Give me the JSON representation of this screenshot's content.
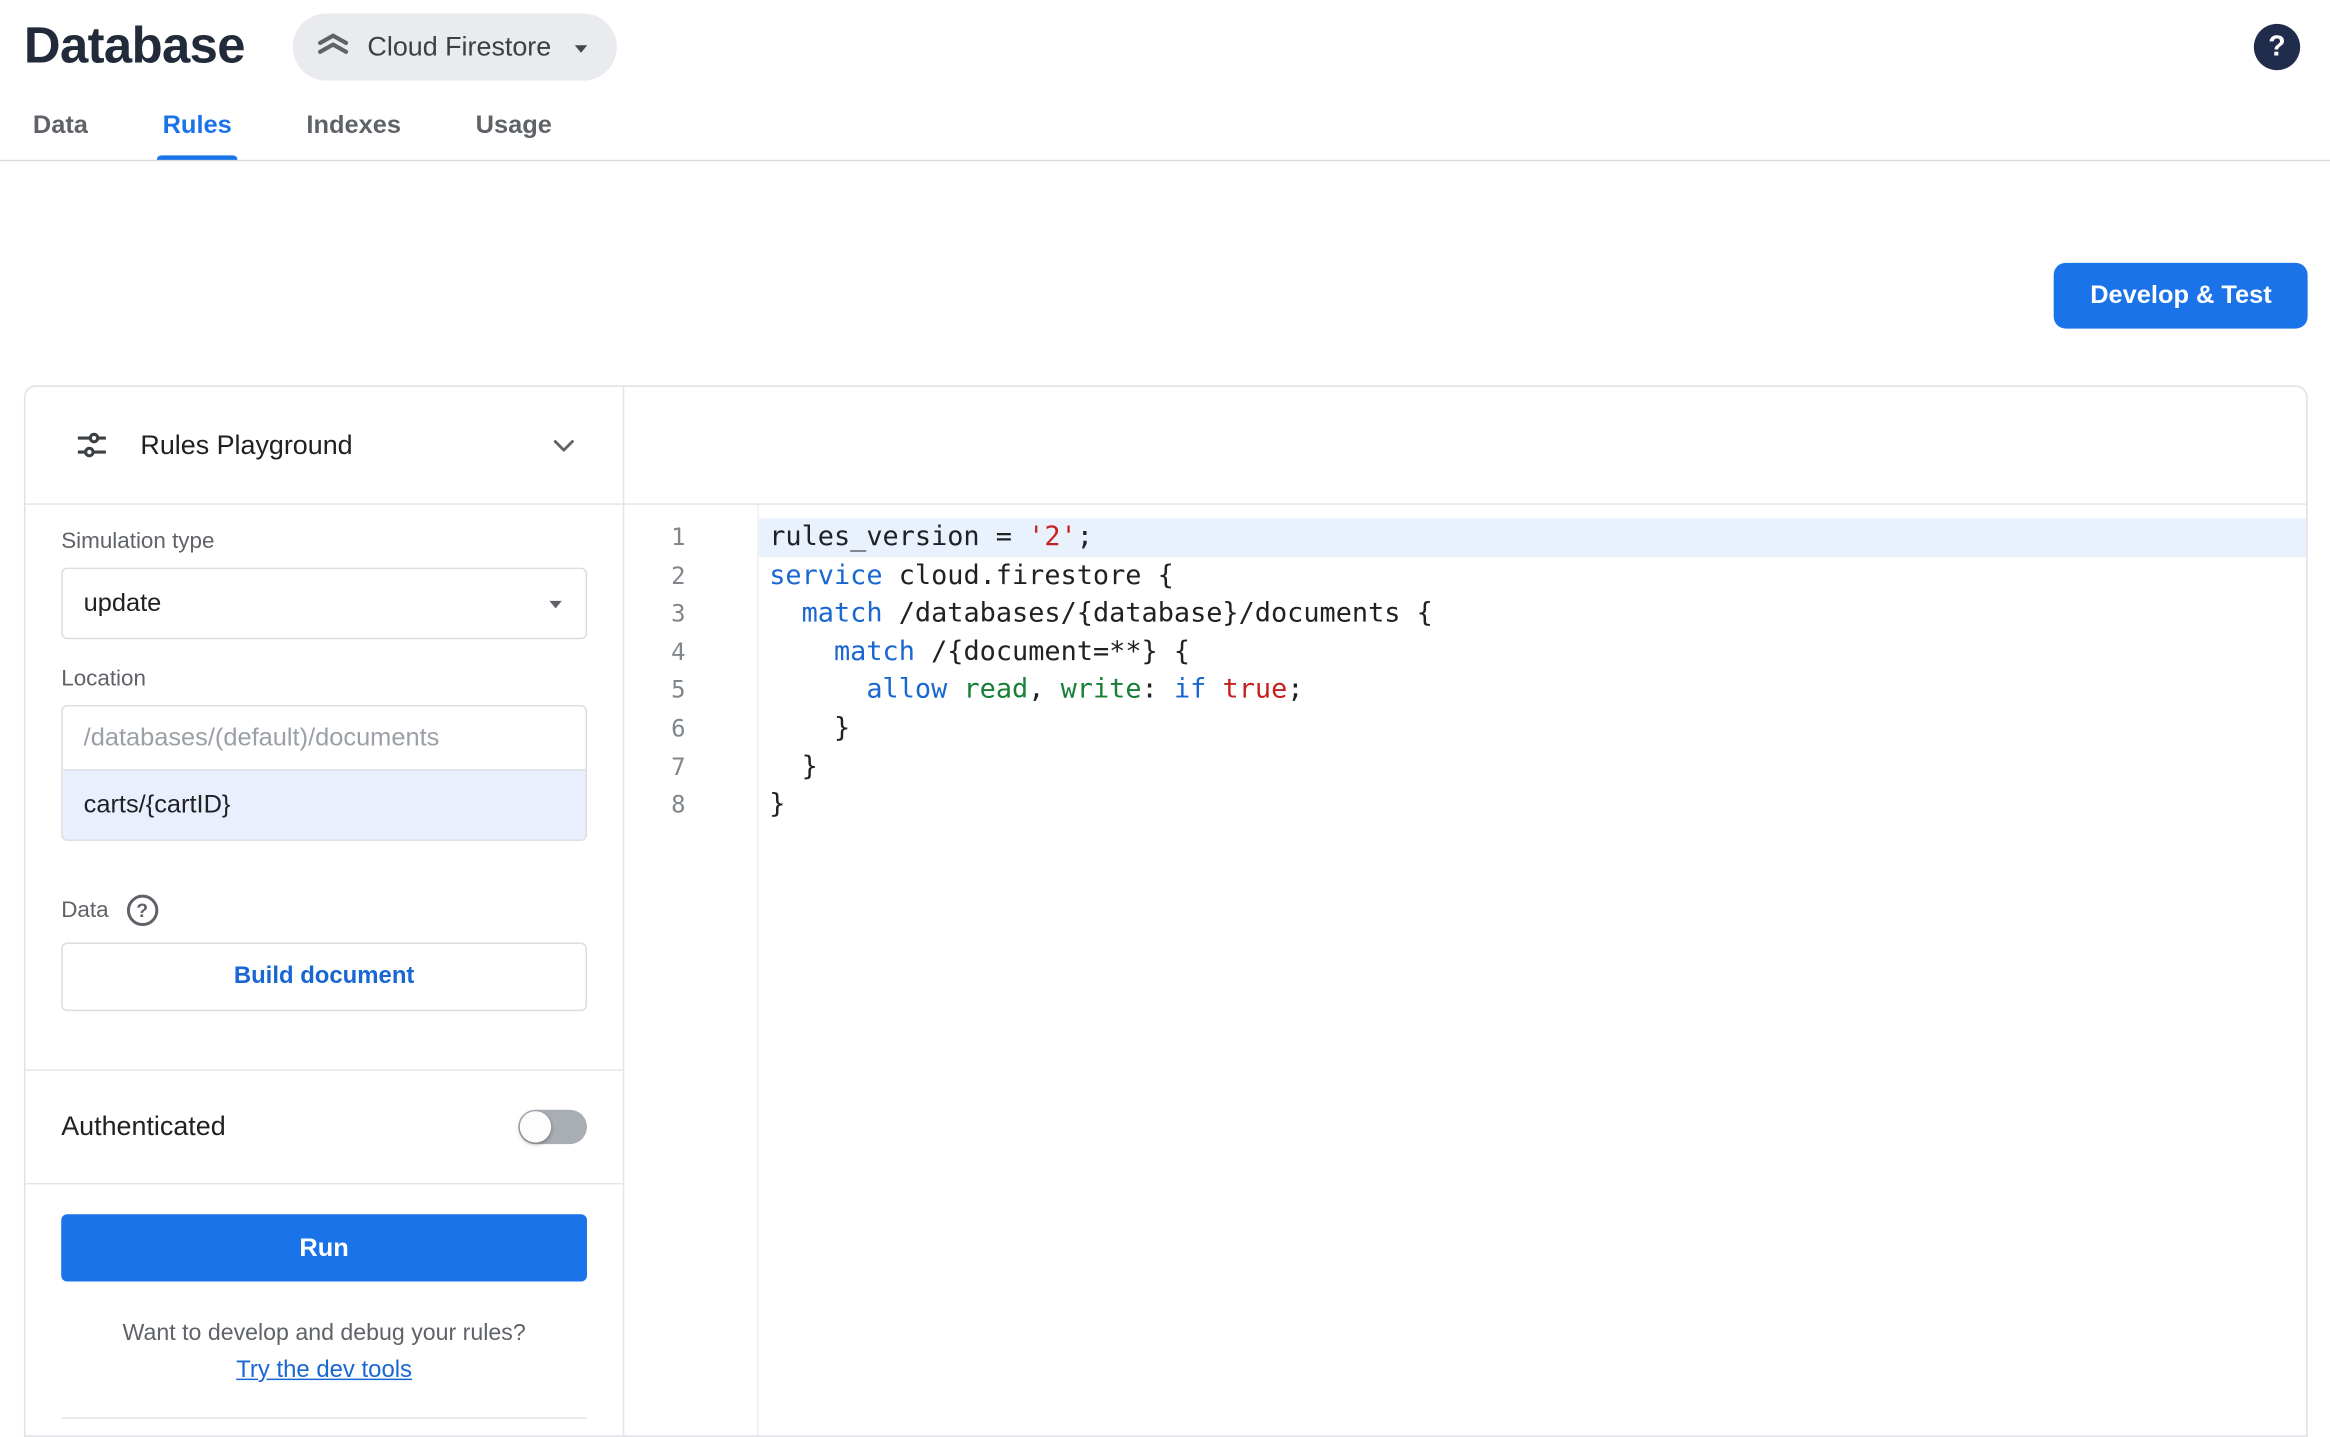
{
  "header": {
    "title": "Database",
    "product_chip": "Cloud Firestore",
    "help_glyph": "?"
  },
  "tabs": [
    {
      "label": "Data"
    },
    {
      "label": "Rules"
    },
    {
      "label": "Indexes"
    },
    {
      "label": "Usage"
    }
  ],
  "active_tab": "Rules",
  "toolbar": {
    "develop_test_label": "Develop & Test"
  },
  "playground": {
    "title": "Rules Playground",
    "simulation_type_label": "Simulation type",
    "simulation_type_value": "update",
    "location_label": "Location",
    "location_placeholder": "/databases/(default)/documents",
    "location_value": "carts/{cartID}",
    "data_label": "Data",
    "data_help_glyph": "?",
    "build_document_label": "Build document",
    "authenticated_label": "Authenticated",
    "authenticated_enabled": false,
    "run_label": "Run",
    "hint_text": "Want to develop and debug your rules?",
    "devtools_link_label": "Try the dev tools"
  },
  "editor": {
    "lines": [
      {
        "num": 1,
        "highlight": true,
        "tokens": [
          {
            "t": "rules_version = "
          },
          {
            "t": "'2'",
            "c": "str"
          },
          {
            "t": ";"
          }
        ]
      },
      {
        "num": 2,
        "highlight": false,
        "tokens": [
          {
            "t": "service",
            "c": "kw"
          },
          {
            "t": " cloud.firestore {"
          }
        ]
      },
      {
        "num": 3,
        "highlight": false,
        "tokens": [
          {
            "t": "  "
          },
          {
            "t": "match",
            "c": "kw"
          },
          {
            "t": " /databases/{database}/documents {"
          }
        ]
      },
      {
        "num": 4,
        "highlight": false,
        "tokens": [
          {
            "t": "    "
          },
          {
            "t": "match",
            "c": "kw"
          },
          {
            "t": " /{document=**} {"
          }
        ]
      },
      {
        "num": 5,
        "highlight": false,
        "tokens": [
          {
            "t": "      "
          },
          {
            "t": "allow",
            "c": "kw"
          },
          {
            "t": " "
          },
          {
            "t": "read",
            "c": "prop"
          },
          {
            "t": ", "
          },
          {
            "t": "write",
            "c": "prop"
          },
          {
            "t": ": "
          },
          {
            "t": "if",
            "c": "kw"
          },
          {
            "t": " "
          },
          {
            "t": "true",
            "c": "bool"
          },
          {
            "t": ";"
          }
        ]
      },
      {
        "num": 6,
        "highlight": false,
        "tokens": [
          {
            "t": "    }"
          }
        ]
      },
      {
        "num": 7,
        "highlight": false,
        "tokens": [
          {
            "t": "  }"
          }
        ]
      },
      {
        "num": 8,
        "highlight": false,
        "tokens": [
          {
            "t": "}"
          }
        ]
      }
    ]
  },
  "colors": {
    "accent_blue": "#1a73e8",
    "keyword": "#1967d2",
    "string": "#c5221f",
    "property_green": "#188038",
    "line_highlight": "#e9f1fd"
  }
}
